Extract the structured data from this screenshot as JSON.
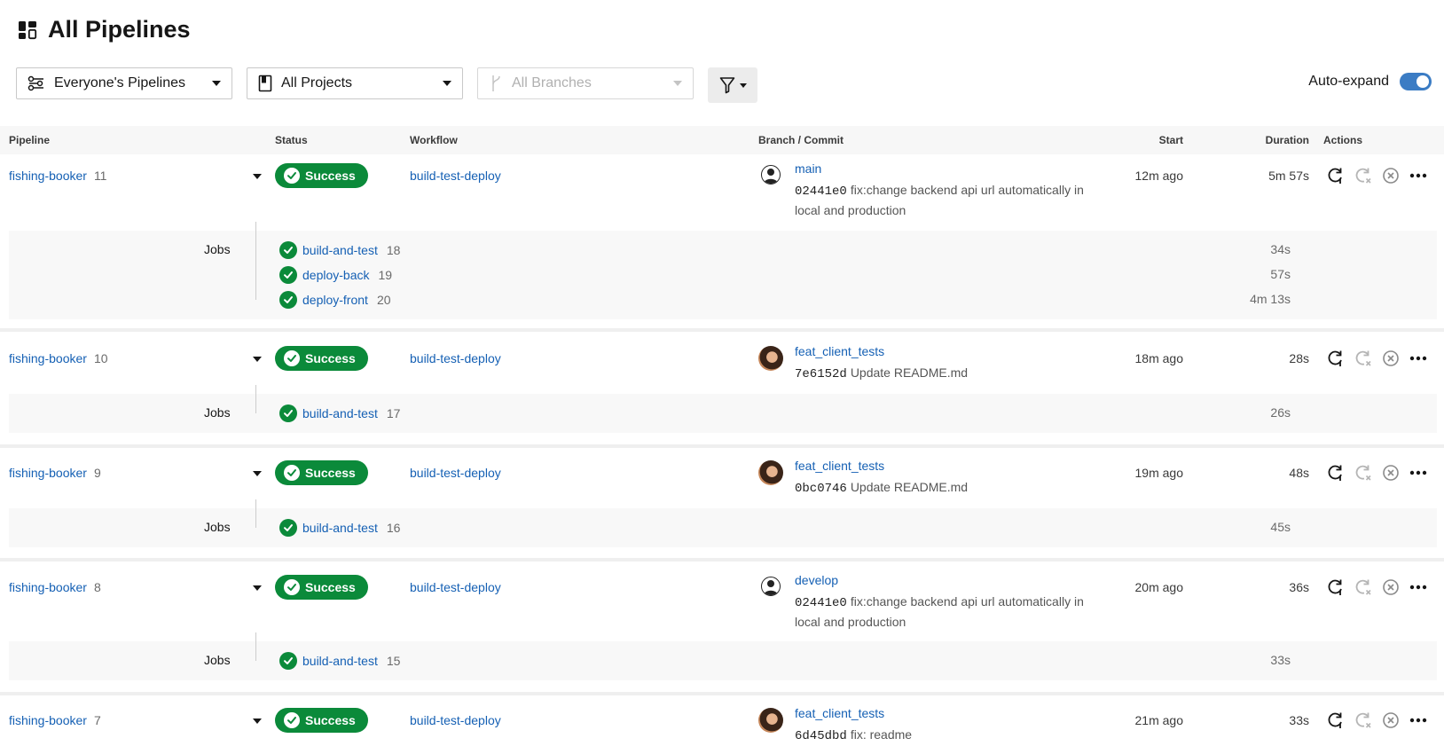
{
  "page": {
    "title": "All Pipelines"
  },
  "filters": {
    "pipelines_select": "Everyone's Pipelines",
    "projects_select": "All Projects",
    "branches_select": "All Branches",
    "auto_expand_label": "Auto-expand",
    "auto_expand_on": true
  },
  "table": {
    "headers": [
      "Pipeline",
      "Status",
      "Workflow",
      "Branch / Commit",
      "Start",
      "Duration",
      "Actions"
    ],
    "jobs_label": "Jobs",
    "pipelines": [
      {
        "project": "fishing-booker",
        "number": "11",
        "status": "Success",
        "workflow": "build-test-deploy",
        "avatar": "generic-user-icon",
        "branch": "main",
        "sha": "02441e0",
        "message": "fix:change backend api url automatically in local and production",
        "start": "12m ago",
        "duration": "5m 57s",
        "jobs": [
          {
            "name": "build-and-test",
            "number": "18",
            "duration": "34s"
          },
          {
            "name": "deploy-back",
            "number": "19",
            "duration": "57s"
          },
          {
            "name": "deploy-front",
            "number": "20",
            "duration": "4m 13s"
          }
        ]
      },
      {
        "project": "fishing-booker",
        "number": "10",
        "status": "Success",
        "workflow": "build-test-deploy",
        "avatar": "user-photo",
        "branch": "feat_client_tests",
        "sha": "7e6152d",
        "message": "Update README.md",
        "start": "18m ago",
        "duration": "28s",
        "jobs": [
          {
            "name": "build-and-test",
            "number": "17",
            "duration": "26s"
          }
        ]
      },
      {
        "project": "fishing-booker",
        "number": "9",
        "status": "Success",
        "workflow": "build-test-deploy",
        "avatar": "user-photo",
        "branch": "feat_client_tests",
        "sha": "0bc0746",
        "message": "Update README.md",
        "start": "19m ago",
        "duration": "48s",
        "jobs": [
          {
            "name": "build-and-test",
            "number": "16",
            "duration": "45s"
          }
        ]
      },
      {
        "project": "fishing-booker",
        "number": "8",
        "status": "Success",
        "workflow": "build-test-deploy",
        "avatar": "generic-user-icon",
        "branch": "develop",
        "sha": "02441e0",
        "message": "fix:change backend api url automatically in local and production",
        "start": "20m ago",
        "duration": "36s",
        "jobs": [
          {
            "name": "build-and-test",
            "number": "15",
            "duration": "33s"
          }
        ]
      },
      {
        "project": "fishing-booker",
        "number": "7",
        "status": "Success",
        "workflow": "build-test-deploy",
        "avatar": "user-photo",
        "branch": "feat_client_tests",
        "sha": "6d45dbd",
        "message": "fix: readme",
        "start": "21m ago",
        "duration": "33s",
        "jobs": []
      }
    ]
  },
  "colors": {
    "success": "#0b8a3a",
    "link": "#1560b4",
    "toggle": "#3b7cc4"
  }
}
